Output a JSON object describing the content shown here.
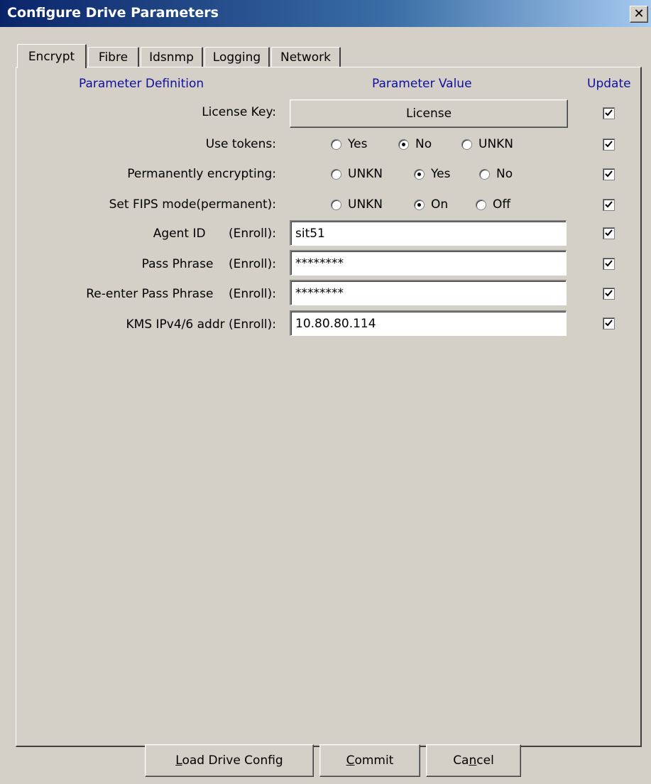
{
  "window": {
    "title": "Configure Drive Parameters",
    "close_glyph": "✕"
  },
  "tabs": [
    {
      "label": "Encrypt",
      "active": true
    },
    {
      "label": "Fibre"
    },
    {
      "label": "Idsnmp"
    },
    {
      "label": "Logging"
    },
    {
      "label": "Network"
    }
  ],
  "headers": {
    "definition": "Parameter Definition",
    "value": "Parameter Value",
    "update": "Update"
  },
  "rows": {
    "license": {
      "label": "License Key:",
      "button": "License",
      "update": true
    },
    "use_tokens": {
      "label": "Use tokens:",
      "options": [
        "Yes",
        "No",
        "UNKN"
      ],
      "selected": "No",
      "update": true
    },
    "perm_encrypting": {
      "label": "Permanently encrypting:",
      "options": [
        "UNKN",
        "Yes",
        "No"
      ],
      "selected": "Yes",
      "update": true
    },
    "fips": {
      "label": "Set FIPS mode(permanent):",
      "options": [
        "UNKN",
        "On",
        "Off"
      ],
      "selected": "On",
      "update": true
    },
    "agent_id": {
      "label": "Agent ID      (Enroll):",
      "value": "sit51",
      "update": true
    },
    "pass_phrase": {
      "label": "Pass Phrase    (Enroll):",
      "value": "********",
      "update": true
    },
    "reenter_pass": {
      "label": "Re-enter Pass Phrase    (Enroll):",
      "value": "********",
      "update": true
    },
    "kms_addr": {
      "label": "KMS IPv4/6 addr (Enroll):",
      "value": "10.80.80.114",
      "update": true
    }
  },
  "buttons": {
    "load": {
      "mnemonic": "L",
      "rest": "oad Drive Config"
    },
    "commit": {
      "mnemonic": "C",
      "rest": "ommit"
    },
    "cancel": {
      "pre": "Ca",
      "mnemonic": "n",
      "rest": "cel"
    }
  },
  "icons": {
    "checkbox_check": "check-icon"
  }
}
